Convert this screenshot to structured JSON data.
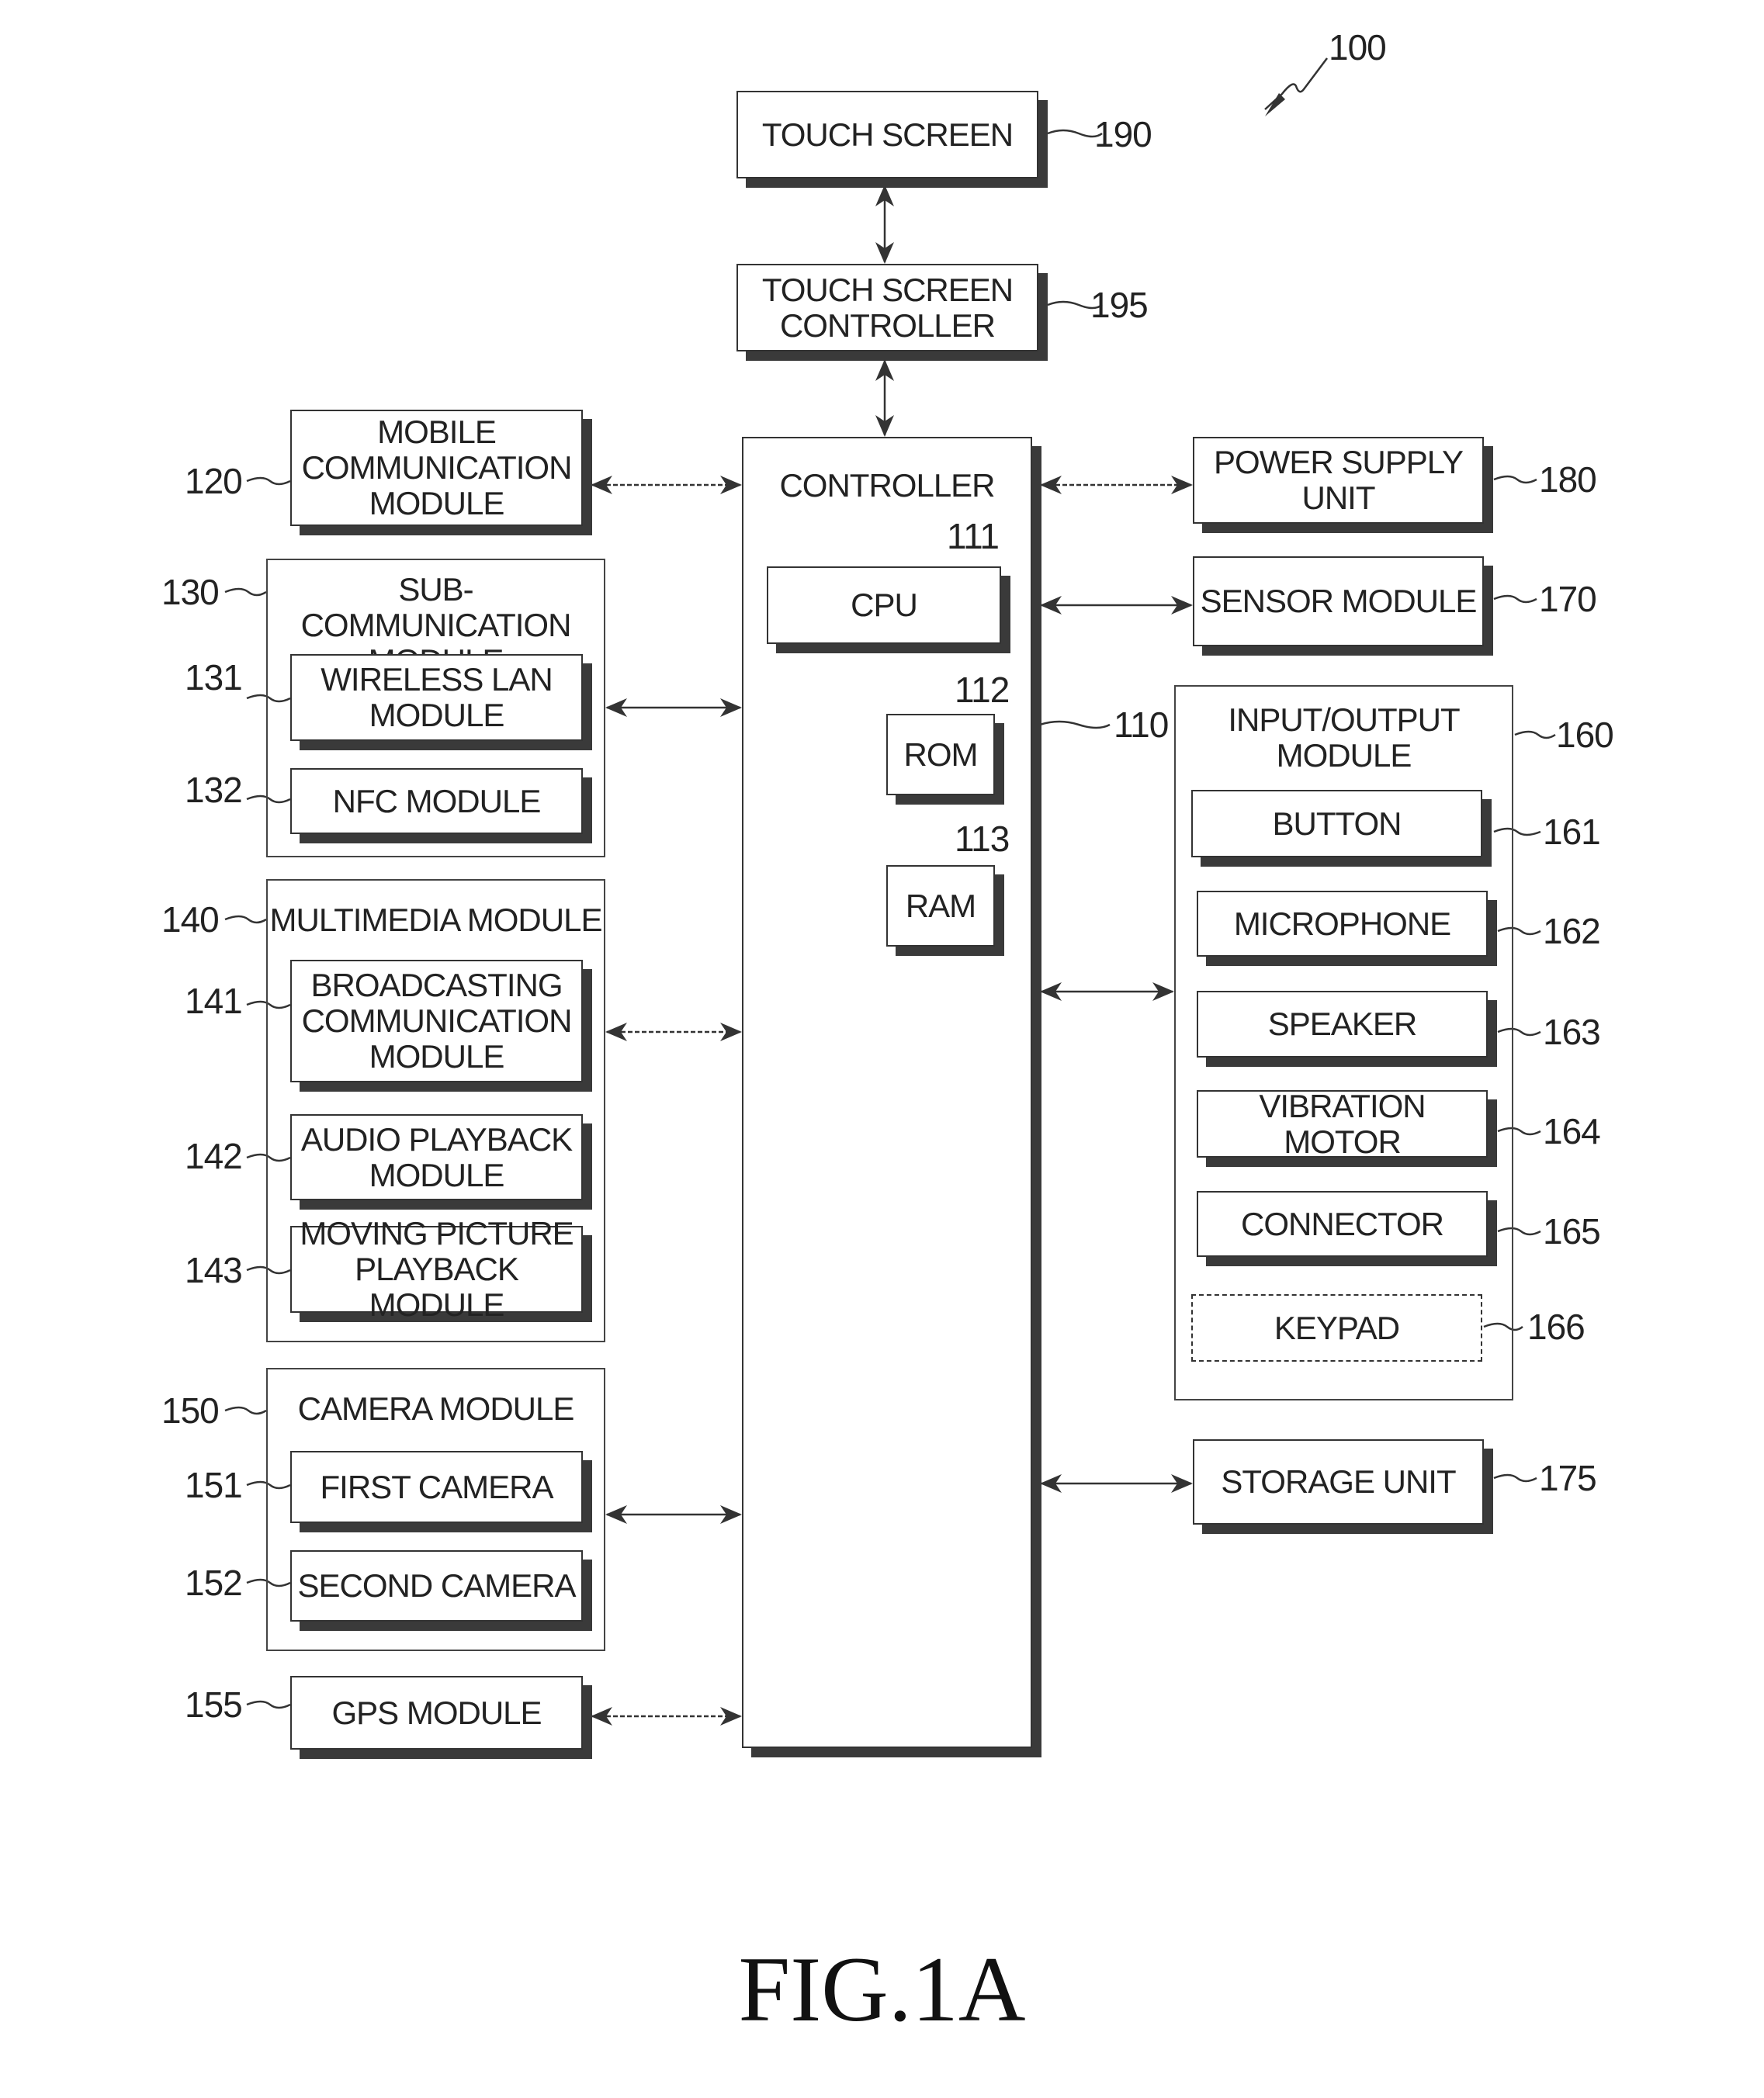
{
  "figure": {
    "caption": "FIG.1A",
    "device_ref": "100"
  },
  "center": {
    "touch_screen": {
      "label": "TOUCH SCREEN",
      "ref": "190"
    },
    "touch_screen_controller": {
      "label": "TOUCH SCREEN\nCONTROLLER",
      "ref": "195"
    },
    "controller": {
      "label": "CONTROLLER",
      "ref": "110",
      "cpu": {
        "label": "CPU",
        "ref": "111"
      },
      "rom": {
        "label": "ROM",
        "ref": "112"
      },
      "ram": {
        "label": "RAM",
        "ref": "113"
      }
    }
  },
  "left": {
    "mobile_communication": {
      "label": "MOBILE\nCOMMUNICATION\nMODULE",
      "ref": "120"
    },
    "sub_communication": {
      "label": "SUB-COMMUNICATION\nMODULE",
      "ref": "130",
      "wireless_lan": {
        "label": "WIRELESS LAN\nMODULE",
        "ref": "131"
      },
      "nfc": {
        "label": "NFC MODULE",
        "ref": "132"
      }
    },
    "multimedia": {
      "label": "MULTIMEDIA MODULE",
      "ref": "140",
      "broadcasting": {
        "label": "BROADCASTING\nCOMMUNICATION\nMODULE",
        "ref": "141"
      },
      "audio_playback": {
        "label": "AUDIO PLAYBACK\nMODULE",
        "ref": "142"
      },
      "moving_picture": {
        "label": "MOVING PICTURE\nPLAYBACK MODULE",
        "ref": "143"
      }
    },
    "camera": {
      "label": "CAMERA MODULE",
      "ref": "150",
      "first_camera": {
        "label": "FIRST CAMERA",
        "ref": "151"
      },
      "second_camera": {
        "label": "SECOND CAMERA",
        "ref": "152"
      }
    },
    "gps": {
      "label": "GPS MODULE",
      "ref": "155"
    }
  },
  "right": {
    "power_supply": {
      "label": "POWER SUPPLY\nUNIT",
      "ref": "180"
    },
    "sensor": {
      "label": "SENSOR MODULE",
      "ref": "170"
    },
    "io": {
      "label": "INPUT/OUTPUT\nMODULE",
      "ref": "160",
      "button": {
        "label": "BUTTON",
        "ref": "161"
      },
      "microphone": {
        "label": "MICROPHONE",
        "ref": "162"
      },
      "speaker": {
        "label": "SPEAKER",
        "ref": "163"
      },
      "vibration_motor": {
        "label": "VIBRATION MOTOR",
        "ref": "164"
      },
      "connector": {
        "label": "CONNECTOR",
        "ref": "165"
      },
      "keypad": {
        "label": "KEYPAD",
        "ref": "166",
        "optional": true
      }
    },
    "storage": {
      "label": "STORAGE UNIT",
      "ref": "175"
    }
  }
}
